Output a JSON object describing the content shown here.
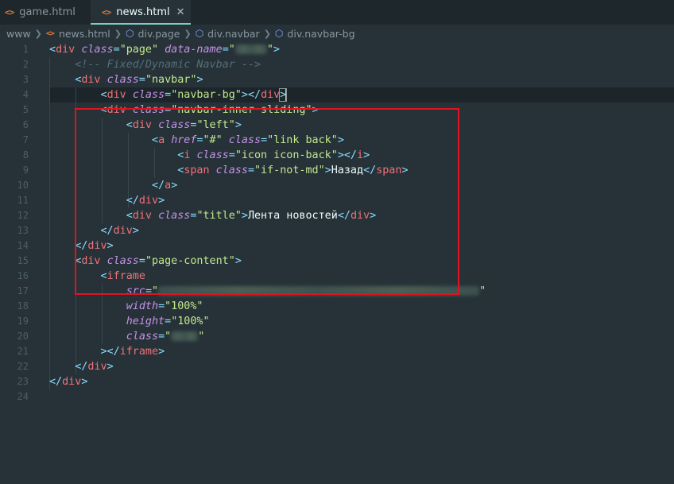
{
  "tabs": [
    {
      "label": "game.html",
      "active": false
    },
    {
      "label": "news.html",
      "active": true
    }
  ],
  "breadcrumb": [
    "www",
    "news.html",
    "div.page",
    "div.navbar",
    "div.navbar-bg"
  ],
  "line_numbers": [
    "1",
    "2",
    "3",
    "4",
    "5",
    "6",
    "7",
    "8",
    "9",
    "10",
    "11",
    "12",
    "13",
    "14",
    "15",
    "16",
    "17",
    "18",
    "19",
    "20",
    "21",
    "22",
    "23",
    "24"
  ],
  "code": {
    "l1": {
      "lt": "<",
      "tag": "div",
      "a1": "class",
      "eq1": "=",
      "v1": "\"page\"",
      "a2": "data-name",
      "eq2": "=",
      "q1": "\"",
      "q2": "\"",
      "gt": ">"
    },
    "l2": {
      "comment": "<!-- Fixed/Dynamic Navbar -->"
    },
    "l3": {
      "lt": "<",
      "tag": "div",
      "a1": "class",
      "eq1": "=",
      "v1": "\"navbar\"",
      "gt": ">"
    },
    "l4": {
      "lt": "<",
      "tag": "div",
      "a1": "class",
      "eq1": "=",
      "v1": "\"navbar-bg\"",
      "gt": ">",
      "clt": "</",
      "ctag": "div",
      "cgt": ">"
    },
    "l5": {
      "lt": "<",
      "tag": "div",
      "a1": "class",
      "eq1": "=",
      "v1": "\"navbar-inner sliding\"",
      "gt": ">"
    },
    "l6": {
      "lt": "<",
      "tag": "div",
      "a1": "class",
      "eq1": "=",
      "v1": "\"left\"",
      "gt": ">"
    },
    "l7": {
      "lt": "<",
      "tag": "a",
      "a1": "href",
      "eq1": "=",
      "v1": "\"#\"",
      "a2": "class",
      "eq2": "=",
      "v2": "\"link back\"",
      "gt": ">"
    },
    "l8": {
      "lt": "<",
      "tag": "i",
      "a1": "class",
      "eq1": "=",
      "v1": "\"icon icon-back\"",
      "gt": ">",
      "clt": "</",
      "ctag": "i",
      "cgt": ">"
    },
    "l9": {
      "lt": "<",
      "tag": "span",
      "a1": "class",
      "eq1": "=",
      "v1": "\"if-not-md\"",
      "gt": ">",
      "text": "Назад",
      "clt": "</",
      "ctag": "span",
      "cgt": ">"
    },
    "l10": {
      "clt": "</",
      "ctag": "a",
      "cgt": ">"
    },
    "l11": {
      "clt": "</",
      "ctag": "div",
      "cgt": ">"
    },
    "l12": {
      "lt": "<",
      "tag": "div",
      "a1": "class",
      "eq1": "=",
      "v1": "\"title\"",
      "gt": ">",
      "text": "Лента новостей",
      "clt": "</",
      "ctag": "div",
      "cgt": ">"
    },
    "l13": {
      "clt": "</",
      "ctag": "div",
      "cgt": ">"
    },
    "l14": {
      "clt": "</",
      "ctag": "div",
      "cgt": ">"
    },
    "l15": {
      "lt": "<",
      "tag": "div",
      "a1": "class",
      "eq1": "=",
      "v1": "\"page-content\"",
      "gt": ">"
    },
    "l16": {
      "lt": "<",
      "tag": "iframe"
    },
    "l17": {
      "a1": "src",
      "eq1": "=",
      "q1": "\"",
      "q2": "\""
    },
    "l18": {
      "a1": "width",
      "eq1": "=",
      "v1": "\"100%\""
    },
    "l19": {
      "a1": "height",
      "eq1": "=",
      "v1": "\"100%\""
    },
    "l20": {
      "a1": "class",
      "eq1": "=",
      "q1": "\"",
      "q2": "\""
    },
    "l21": {
      "gt": "></",
      "ctag": "iframe",
      "cgt": ">"
    },
    "l22": {
      "clt": "</",
      "ctag": "div",
      "cgt": ">"
    },
    "l23": {
      "clt": "</",
      "ctag": "div",
      "cgt": ">"
    }
  },
  "colors": {
    "highlight_box": "#e0141e",
    "cursor": "#ffcc00",
    "accent": "#80cbc4"
  }
}
